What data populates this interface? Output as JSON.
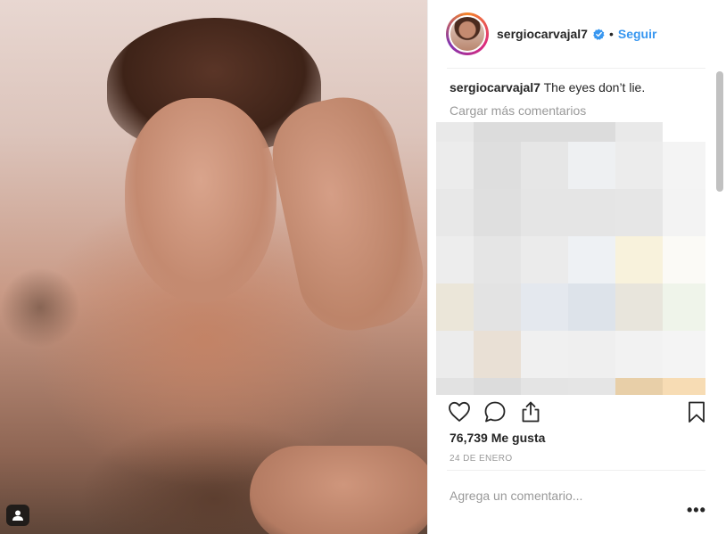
{
  "post": {
    "username": "sergiocarvajal7",
    "follow_label": "Seguir",
    "separator_dot": "•",
    "caption_user": "sergiocarvajal7",
    "caption_text": "The eyes don’t lie.",
    "load_more_label": "Cargar más comentarios",
    "likes": "76,739 Me gusta",
    "date": "24 DE ENERO",
    "comment_placeholder": "Agrega un comentario...",
    "more_options": "•••"
  },
  "icons": {
    "verified": "verified-badge-icon",
    "like": "heart-icon",
    "comment": "speech-bubble-icon",
    "share": "share-upload-icon",
    "save": "bookmark-icon",
    "tag": "user-tag-icon"
  },
  "colors": {
    "accent": "#3897f0",
    "text": "#262626",
    "muted": "#999999",
    "border": "#efefef"
  },
  "pixelated_comments": [
    "#e9e9e9",
    "#dcdcdc",
    "#dcdcdc",
    "#dcdcdc",
    "#e9e9e9",
    "#ffffff",
    "#ececec",
    "#dedede",
    "#e6e6e6",
    "#eef0f2",
    "#ececec",
    "#f4f4f4",
    "#e8e8e8",
    "#dfdfdf",
    "#e5e5e5",
    "#e5e5e5",
    "#e6e6e6",
    "#f3f3f3",
    "#ededed",
    "#e5e5e5",
    "#ebebeb",
    "#eef1f4",
    "#f8f2dc",
    "#fbfaf6",
    "#ebe6d9",
    "#e3e3e3",
    "#e4e8ee",
    "#dde3ea",
    "#e8e5dc",
    "#eff4ea",
    "#ececec",
    "#e9e0d5",
    "#f0f0f0",
    "#efefef",
    "#f2f2f2",
    "#f4f4f4",
    "#e2e2e2",
    "#dcdcdc",
    "#e4e4e4",
    "#e5e5e5",
    "#e8cfa8",
    "#f7dcb4"
  ]
}
